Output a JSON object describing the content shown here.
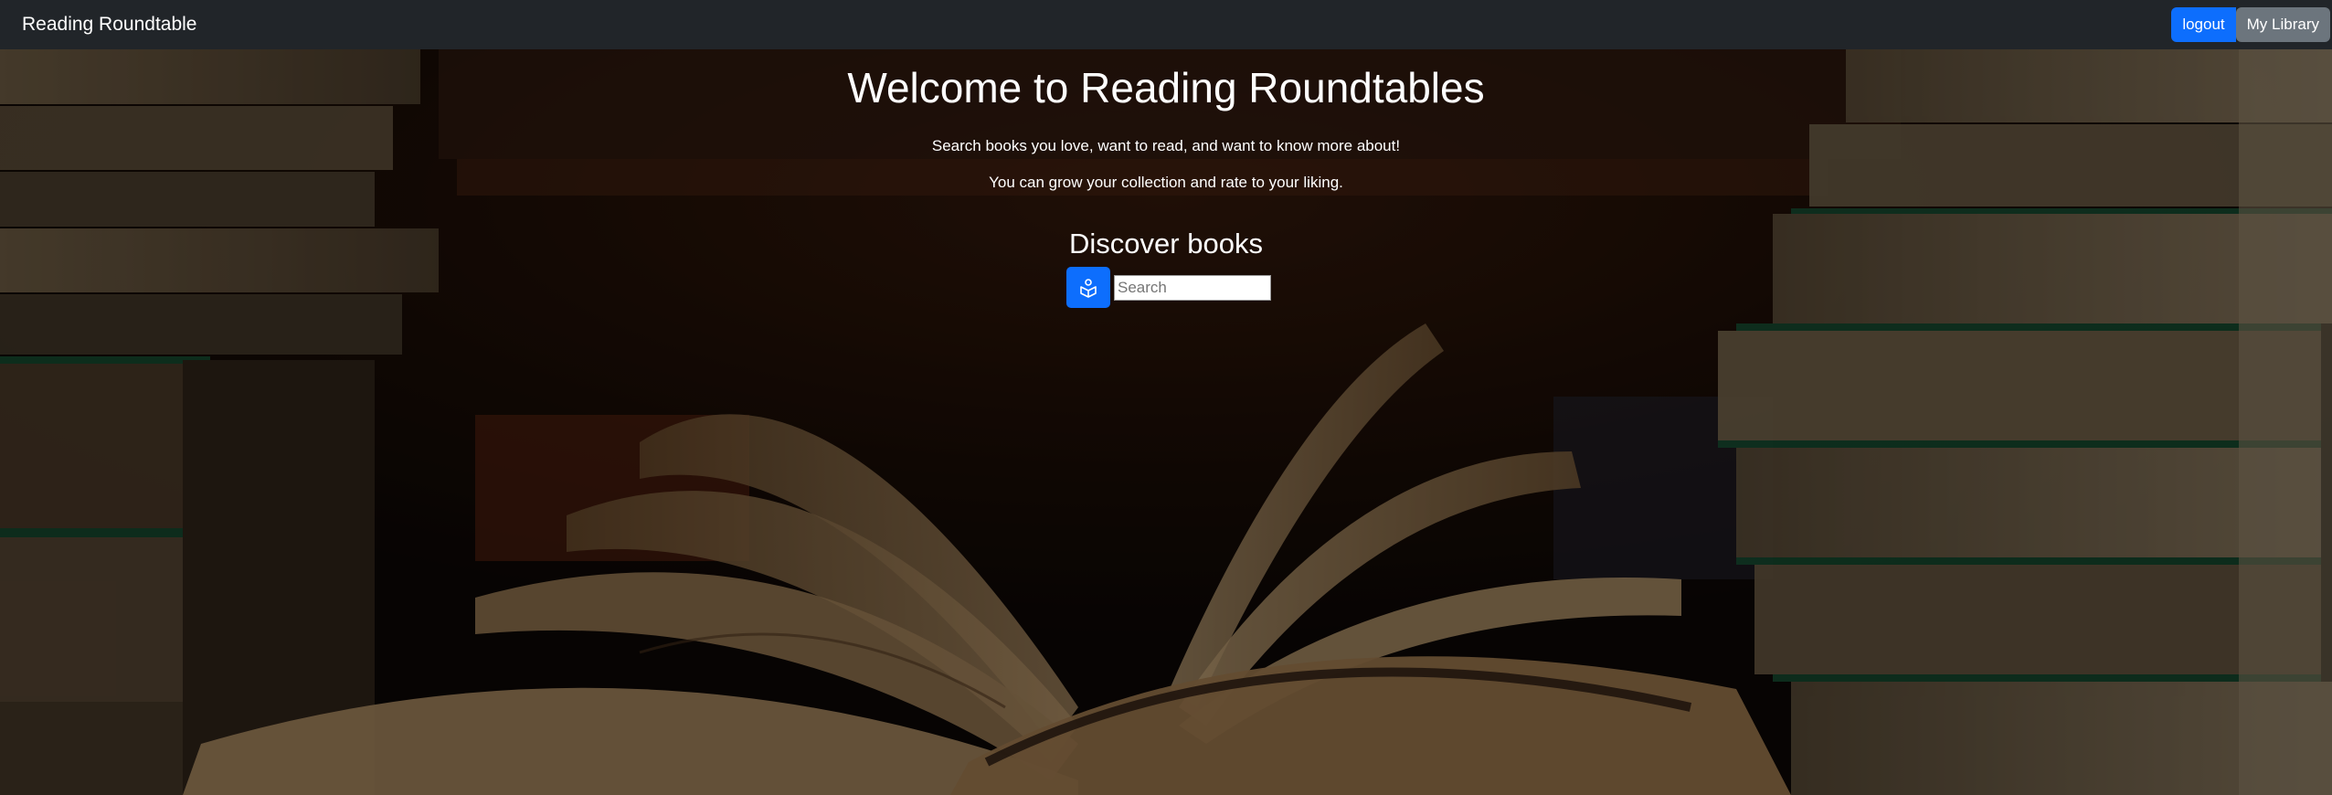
{
  "navbar": {
    "brand": "Reading Roundtable",
    "logout_label": "logout",
    "library_label": "My Library"
  },
  "hero": {
    "title": "Welcome to Reading Roundtables",
    "subtitle_1": "Search books you love, want to read, and want to know more about!",
    "subtitle_2": "You can grow your collection and rate to your liking.",
    "discover_heading": "Discover books",
    "search_icon": "book-search-icon",
    "search_placeholder": "Search",
    "search_value": ""
  },
  "colors": {
    "navbar_bg": "#212529",
    "primary": "#0d6efd",
    "secondary": "#6c757d"
  }
}
